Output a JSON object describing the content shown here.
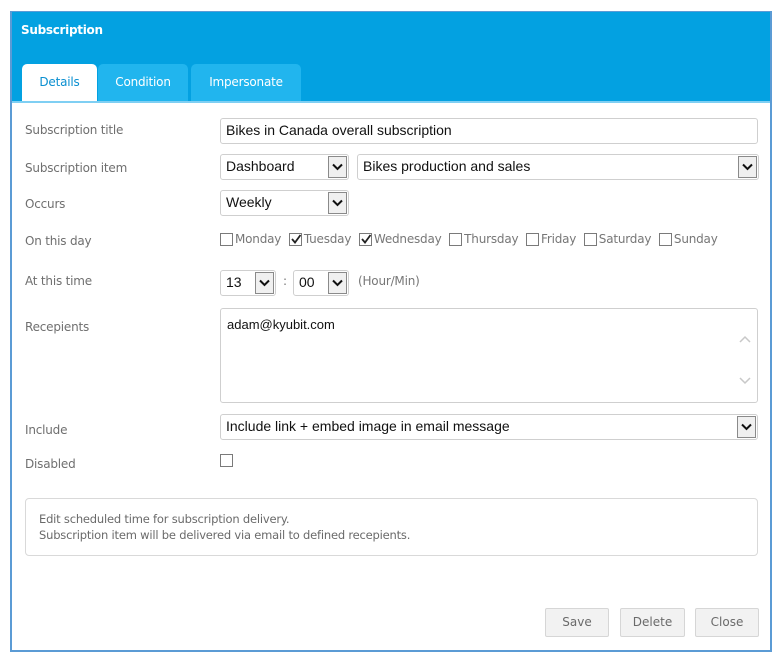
{
  "dialog": {
    "title": "Subscription"
  },
  "tabs": [
    {
      "label": "Details",
      "active": true
    },
    {
      "label": "Condition",
      "active": false
    },
    {
      "label": "Impersonate",
      "active": false
    }
  ],
  "form": {
    "title": {
      "label": "Subscription title",
      "value": "Bikes in Canada overall subscription"
    },
    "item": {
      "label": "Subscription item",
      "type_value": "Dashboard",
      "item_value": "Bikes production and sales"
    },
    "occurs": {
      "label": "Occurs",
      "value": "Weekly"
    },
    "on_this_day": {
      "label": "On this day",
      "days": [
        {
          "label": "Monday",
          "checked": false
        },
        {
          "label": "Tuesday",
          "checked": true
        },
        {
          "label": "Wednesday",
          "checked": true
        },
        {
          "label": "Thursday",
          "checked": false
        },
        {
          "label": "Friday",
          "checked": false
        },
        {
          "label": "Saturday",
          "checked": false
        },
        {
          "label": "Sunday",
          "checked": false
        }
      ]
    },
    "time": {
      "label": "At this time",
      "hour": "13",
      "separator": ":",
      "minute": "00",
      "hint": "(Hour/Min)"
    },
    "recipients": {
      "label": "Recepients",
      "value": "adam@kyubit.com"
    },
    "include": {
      "label": "Include",
      "value": "Include link + embed image in email message"
    },
    "disabled": {
      "label": "Disabled",
      "checked": false
    }
  },
  "info": {
    "line1": "Edit scheduled time for subscription delivery.",
    "line2": "Subscription item will be delivered via email to defined recepients."
  },
  "buttons": {
    "save": "Save",
    "delete": "Delete",
    "close": "Close"
  },
  "colors": {
    "header": "#03a1e1",
    "tab_inactive": "#21b5ee",
    "tab_active_text": "#0a8fd0",
    "border": "#5b9bd5"
  }
}
